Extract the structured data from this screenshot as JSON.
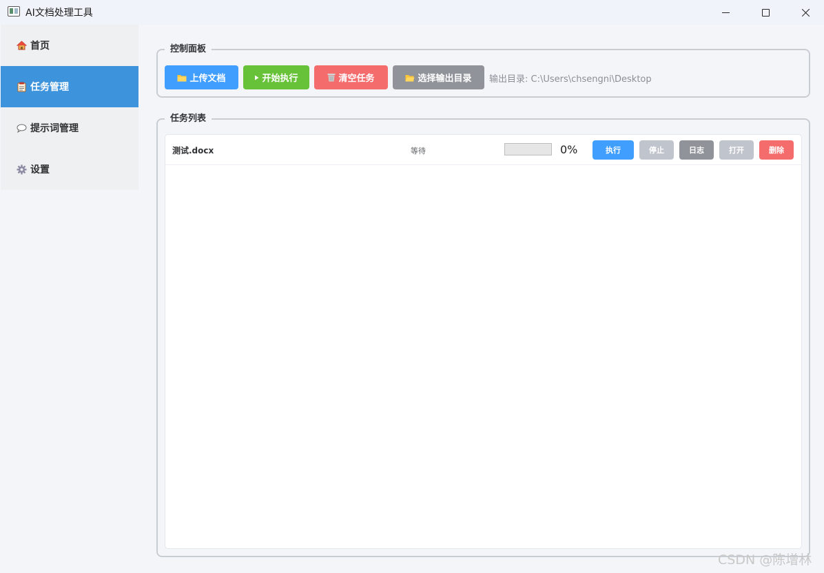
{
  "window": {
    "title": "AI文档处理工具"
  },
  "sidebar": {
    "items": [
      {
        "label": "首页",
        "icon": "house-icon",
        "active": false
      },
      {
        "label": "任务管理",
        "icon": "notepad-icon",
        "active": true
      },
      {
        "label": "提示词管理",
        "icon": "speech-bubble-icon",
        "active": false
      },
      {
        "label": "设置",
        "icon": "gear-icon",
        "active": false
      }
    ]
  },
  "control_panel": {
    "title": "控制面板",
    "buttons": {
      "upload": "上传文档",
      "start": "开始执行",
      "clear": "清空任务",
      "output_dir": "选择输出目录"
    },
    "output_dir_text": "输出目录: C:\\Users\\chsengni\\Desktop"
  },
  "task_list": {
    "title": "任务列表",
    "tasks": [
      {
        "name": "测试.docx",
        "status": "等待",
        "progress": 0,
        "progress_text": "0%",
        "actions": {
          "execute": "执行",
          "stop": "停止",
          "log": "日志",
          "open": "打开",
          "delete": "删除"
        }
      }
    ]
  },
  "watermark": "CSDN @陈增林",
  "colors": {
    "primary": "#409eff",
    "success": "#67c23a",
    "danger": "#f56c6c",
    "info": "#909399",
    "disabled": "#c0c4cc",
    "sidebar_active": "#3d93dc"
  }
}
